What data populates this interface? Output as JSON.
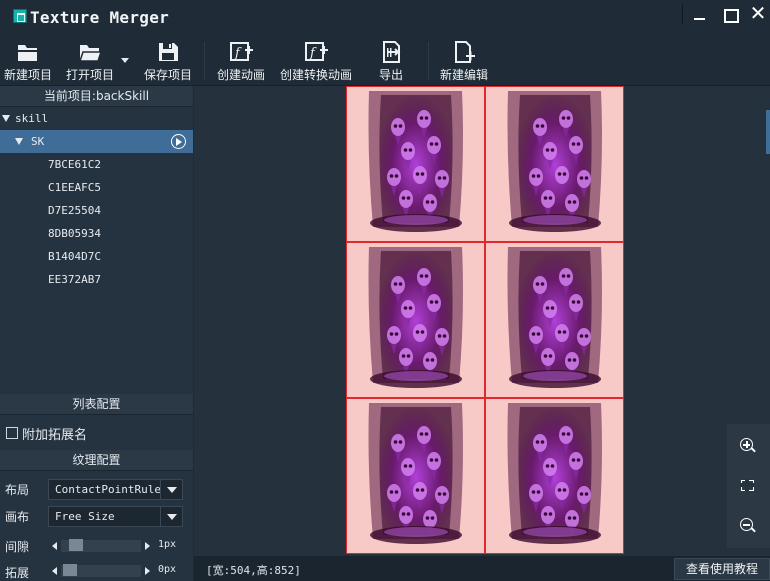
{
  "window": {
    "title": "Texture Merger",
    "minimize": "minimize",
    "maximize": "maximize",
    "close_glyph": "✕"
  },
  "toolbar": {
    "new_project": "新建项目",
    "open_project": "打开项目",
    "save_project": "保存项目",
    "create_animation": "创建动画",
    "create_convert_animation": "创建转换动画",
    "export": "导出",
    "new_edit": "新建编辑"
  },
  "sidebar": {
    "current_project": "当前项目:backSkill",
    "tree": {
      "root": "skill",
      "group": "SK",
      "items": [
        "7BCE61C2",
        "C1EEAFC5",
        "D7E25504",
        "8DB05934",
        "B1404D7C",
        "EE372AB7"
      ]
    },
    "list_config_title": "列表配置",
    "attach_ext_label": "附加拓展名",
    "attach_ext_checked": false,
    "texture_config_title": "纹理配置",
    "layout_label": "布局",
    "layout_value": "ContactPointRule",
    "canvas_label": "画布",
    "canvas_value": "Free Size",
    "gap_label": "间隙",
    "gap_value": "1px",
    "expand_label": "拓展",
    "expand_value": "0px"
  },
  "status": {
    "dimensions": "[宽:504,高:852]",
    "tutorial_button": "查看使用教程"
  },
  "colors": {
    "background": "#1f2b36",
    "selection": "#3f6d97",
    "frame_border": "#e0282d",
    "frame_fill": "#f7c9c7"
  }
}
